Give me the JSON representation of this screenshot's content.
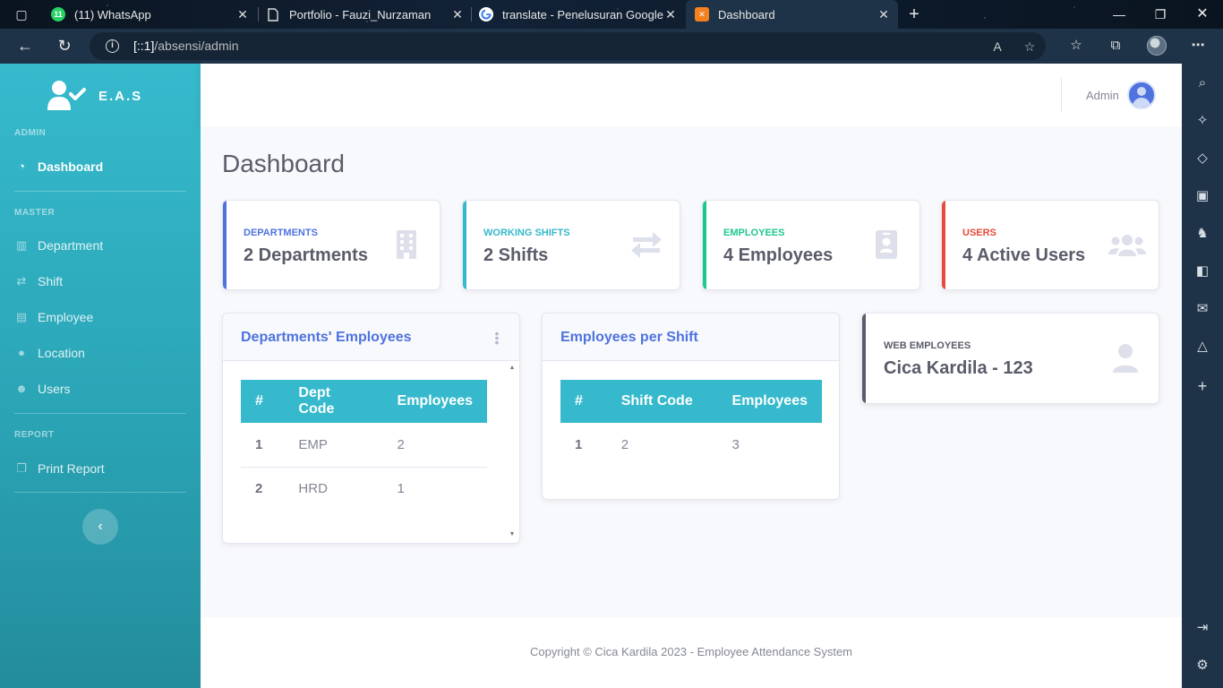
{
  "browser": {
    "tabs": [
      {
        "title": "(11) WhatsApp",
        "badge": "11",
        "favicon_color": "#25d366",
        "favicon": "whatsapp-icon"
      },
      {
        "title": "Portfolio - Fauzi_Nurzaman",
        "favicon_color": "#dddddd",
        "favicon": "document-icon"
      },
      {
        "title": "translate - Penelusuran Google",
        "favicon_color": "#ffffff",
        "favicon": "google-icon"
      },
      {
        "title": "Dashboard",
        "favicon_color": "#f4811f",
        "favicon": "xampp-icon",
        "active": true
      }
    ],
    "url_host": "[::1]",
    "url_path": "/absensi/admin"
  },
  "sidebar": {
    "brand": "E.A.S",
    "sections": {
      "admin": "ADMIN",
      "master": "MASTER",
      "report": "REPORT"
    },
    "items": {
      "dashboard": "Dashboard",
      "department": "Department",
      "shift": "Shift",
      "employee": "Employee",
      "location": "Location",
      "users": "Users",
      "print_report": "Print Report"
    }
  },
  "topbar": {
    "user_name": "Admin"
  },
  "page": {
    "title": "Dashboard"
  },
  "stats": [
    {
      "label": "DEPARTMENTS",
      "value": "2 Departments",
      "color": "#4e73df",
      "icon": "building-icon"
    },
    {
      "label": "WORKING SHIFTS",
      "value": "2 Shifts",
      "color": "#36b9cc",
      "icon": "exchange-icon"
    },
    {
      "label": "EMPLOYEES",
      "value": "4 Employees",
      "color": "#1cc88a",
      "icon": "id-badge-icon"
    },
    {
      "label": "USERS",
      "value": "4 Active Users",
      "color": "#e74a3b",
      "icon": "users-icon"
    }
  ],
  "dept_card": {
    "title": "Departments' Employees",
    "headers": [
      "#",
      "Dept Code",
      "Employees"
    ],
    "rows": [
      [
        "1",
        "EMP",
        "2"
      ],
      [
        "2",
        "HRD",
        "1"
      ]
    ]
  },
  "shift_card": {
    "title": "Employees per Shift",
    "headers": [
      "#",
      "Shift Code",
      "Employees"
    ],
    "rows": [
      [
        "1",
        "2",
        "3"
      ]
    ]
  },
  "web_employees": {
    "label": "WEB EMPLOYEES",
    "value": "Cica Kardila - 123"
  },
  "footer": {
    "text": "Copyright © Cica Kardila 2023 - Employee Attendance System"
  }
}
